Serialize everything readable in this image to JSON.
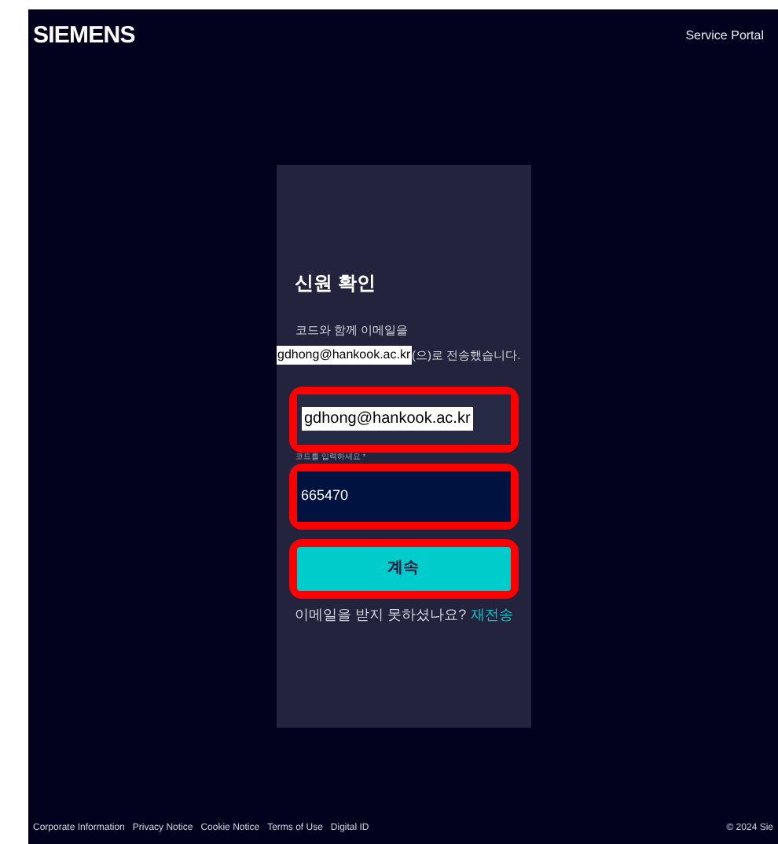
{
  "header": {
    "logo": "SIEMENS",
    "links": [
      "Service Portal"
    ]
  },
  "card": {
    "title": "신원 확인",
    "message_line": "코드와 함께 이메일을",
    "email": "gdhong@hankook.ac.kr",
    "message_suffix": "(으)로 전송했습니다.",
    "email_field": {
      "value": "gdhong@hankook.ac.kr"
    },
    "code_label": "코드를 입력하세요 *",
    "code_field": {
      "value": "665470"
    },
    "continue_button": "계속",
    "resend_prompt": "이메일을 받지 못하셨나요?",
    "resend_link": "재전송"
  },
  "footer": {
    "links": [
      "Corporate Information",
      "Privacy Notice",
      "Cookie Notice",
      "Terms of Use",
      "Digital ID"
    ],
    "copyright": "© 2024 Sie"
  }
}
